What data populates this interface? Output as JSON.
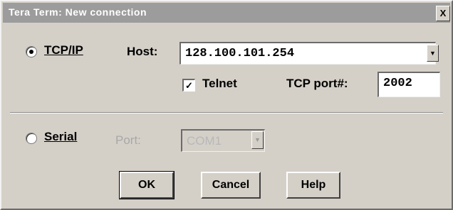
{
  "window": {
    "title": "Tera Term: New connection",
    "close_label": "X"
  },
  "tcpip": {
    "radio_label": "TCP/IP",
    "selected": true,
    "host_label": "Host:",
    "host_value": "128.100.101.254",
    "telnet_label": "Telnet",
    "telnet_checked": true,
    "tcp_port_label": "TCP port#:",
    "tcp_port_value": "2002"
  },
  "serial": {
    "radio_label": "Serial",
    "selected": false,
    "port_label": "Port:",
    "port_value": "COM1"
  },
  "buttons": {
    "ok": "OK",
    "cancel": "Cancel",
    "help": "Help"
  },
  "icons": {
    "dropdown": "chevron-down-icon",
    "check": "checkmark-icon",
    "radio_selected": "radio-dot-icon"
  }
}
